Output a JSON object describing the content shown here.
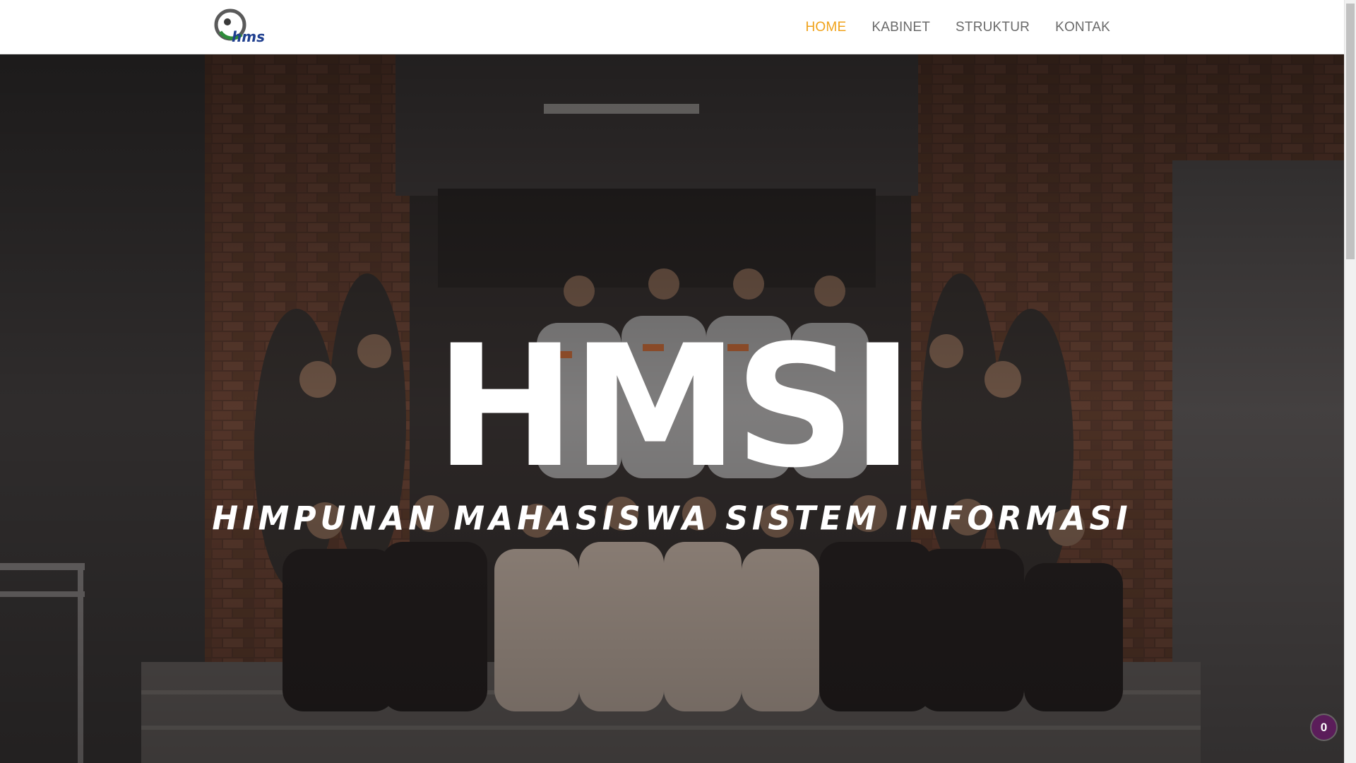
{
  "logo": {
    "text": "hmsi"
  },
  "nav": {
    "items": [
      {
        "label": "HOME",
        "active": true
      },
      {
        "label": "KABINET",
        "active": false
      },
      {
        "label": "STRUKTUR",
        "active": false
      },
      {
        "label": "KONTAK",
        "active": false
      }
    ]
  },
  "hero": {
    "title": "HMSI",
    "subtitle": "HIMPUNAN MAHASISWA SISTEM INFORMASI",
    "background": "group-photo"
  },
  "badge": {
    "count": "0"
  },
  "colors": {
    "accent": "#f0a21a",
    "nav_text": "#6a6a6a",
    "badge_bg": "#5b1d5a",
    "overlay": "#2d2522"
  }
}
